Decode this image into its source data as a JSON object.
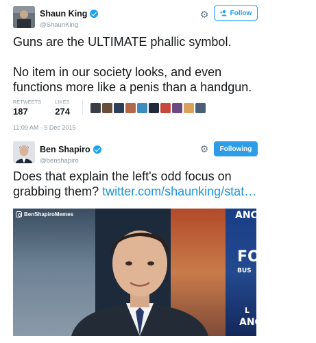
{
  "tweet1": {
    "display_name": "Shaun King",
    "handle": "@ShaunKing",
    "follow_label": "Follow",
    "text_line1": "Guns are the ULTIMATE phallic symbol.",
    "text_line2": "No item in our society looks, and even",
    "text_line3": "functions more like a penis than a handgun.",
    "retweets_label": "RETWEETS",
    "retweets_value": "187",
    "likes_label": "LIKES",
    "likes_value": "274",
    "timestamp": "11:09 AM - 5 Dec 2015",
    "liker_colors": [
      "#3a3f47",
      "#6a4e3c",
      "#2c3e5a",
      "#b3674a",
      "#3f8dbf",
      "#1f2b3d",
      "#c8473c",
      "#6b4a80",
      "#d9a15a",
      "#4a5f7a"
    ]
  },
  "tweet2": {
    "display_name": "Ben Shapiro",
    "handle": "@benshapiro",
    "following_label": "Following",
    "text_line1": "Does that explain the left's odd focus on",
    "text_line2_prefix": "grabbing them? ",
    "text_line2_link": "twitter.com/shaunking/stat…",
    "media": {
      "watermark": "BenShapiroMemes",
      "panel_texts": [
        "ANC",
        "FO",
        "BUS",
        "L",
        "ANC"
      ]
    }
  },
  "colors": {
    "brand_blue": "#1da1f2",
    "link_blue": "#1b95e0",
    "muted_gray": "#8899a6"
  },
  "icons": {
    "verified": "verified-badge-icon",
    "settings": "gear-icon",
    "follow": "add-user-icon",
    "instagram": "instagram-icon"
  }
}
